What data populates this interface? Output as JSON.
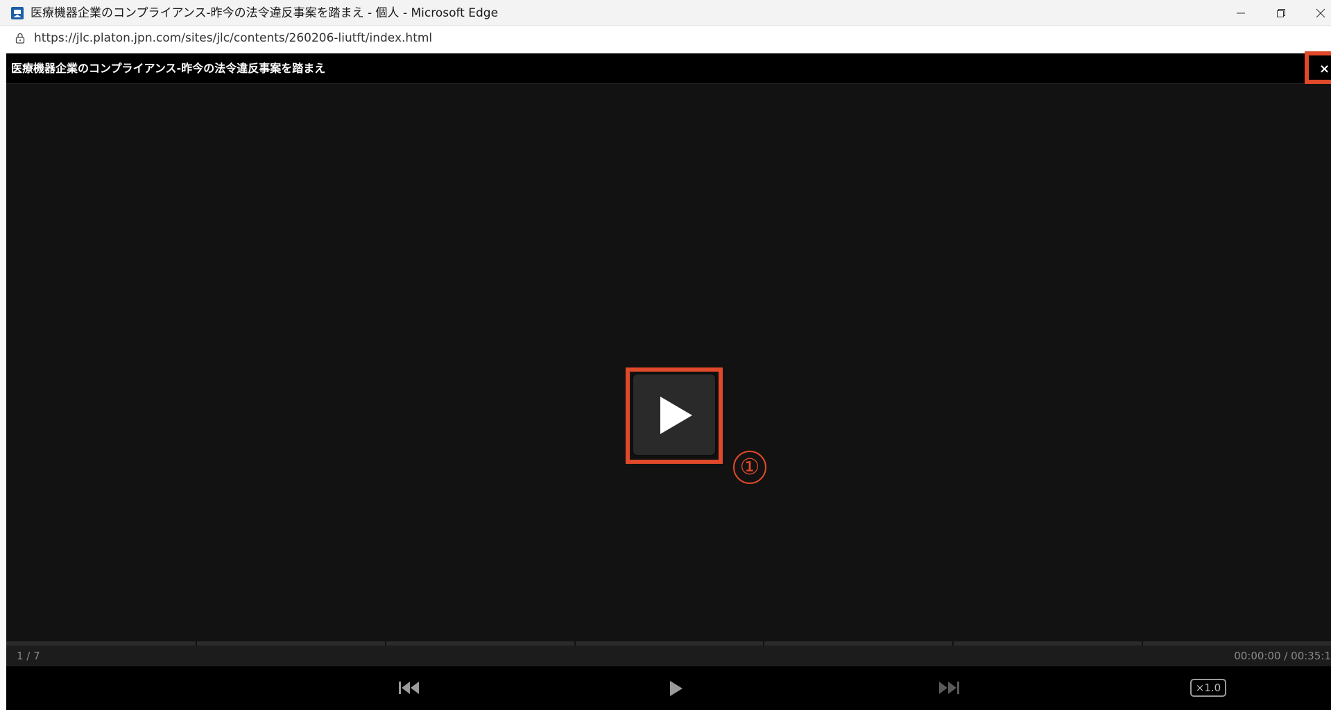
{
  "window": {
    "title": "医療機器企業のコンプライアンス-昨今の法令違反事案を踏まえ - 個人 - Microsoft Edge",
    "url": "https://jlc.platon.jpn.com/sites/jlc/contents/260206-liutft/index.html"
  },
  "player": {
    "title": "医療機器企業のコンプライアンス-昨今の法令違反事案を踏まえ",
    "close_label": "×",
    "step_marker": "①",
    "page_indicator": "1 / 7",
    "time": "00:00:00 / 00:35:1",
    "speed": "×1.0",
    "chapter_count": 7,
    "progress": 0
  },
  "colors": {
    "highlight": "#e0492a",
    "player_bg": "#121212",
    "header_bg": "#000000"
  },
  "icons": {
    "app": "edge-page-icon",
    "lock": "lock-icon",
    "play": "play-icon",
    "prev": "skip-back-icon",
    "next": "skip-forward-icon"
  }
}
